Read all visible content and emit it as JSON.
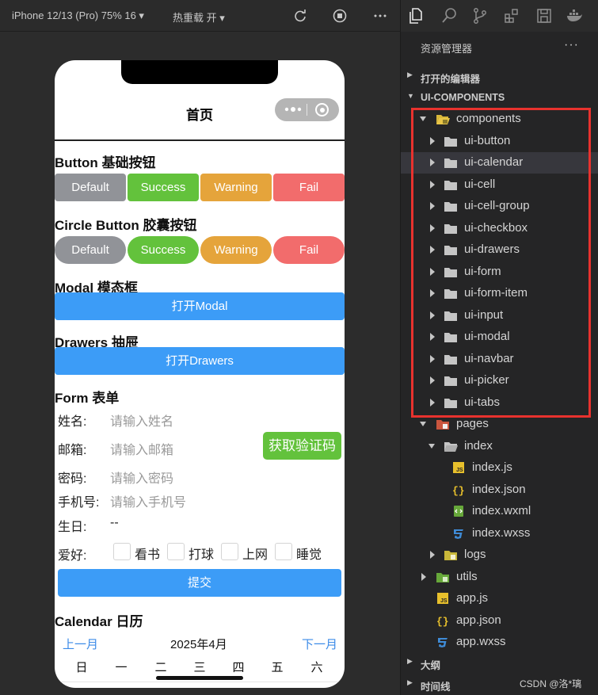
{
  "toolbar": {
    "device": "iPhone 12/13 (Pro) 75% 16 ▾",
    "hot_reload": "热重载 开 ▾"
  },
  "phone": {
    "title": "首页",
    "button_section": {
      "title": "Button 基础按钮",
      "buttons": [
        "Default",
        "Success",
        "Warning",
        "Fail"
      ]
    },
    "circle_section": {
      "title": "Circle Button 胶囊按钮",
      "buttons": [
        "Default",
        "Success",
        "Warning",
        "Fail"
      ]
    },
    "modal_section": {
      "title": "Modal 模态框",
      "button": "打开Modal"
    },
    "drawers_section": {
      "title": "Drawers 抽屉",
      "button": "打开Drawers"
    },
    "form": {
      "title": "Form 表单",
      "name_label": "姓名:",
      "name_placeholder": "请输入姓名",
      "email_label": "邮箱:",
      "email_placeholder": "请输入邮箱",
      "code_button": "获取验证码",
      "password_label": "密码:",
      "password_placeholder": "请输入密码",
      "phone_label": "手机号:",
      "phone_placeholder": "请输入手机号",
      "birthday_label": "生日:",
      "birthday_value": "--",
      "hobby_label": "爱好:",
      "hobbies": [
        "看书",
        "打球",
        "上网",
        "睡觉"
      ],
      "submit": "提交"
    },
    "calendar": {
      "title": "Calendar 日历",
      "prev": "上一月",
      "month": "2025年4月",
      "next": "下一月",
      "weekdays": [
        "日",
        "一",
        "二",
        "三",
        "四",
        "五",
        "六"
      ]
    }
  },
  "explorer": {
    "header": "资源管理器",
    "more": "···",
    "open_editors": "打开的编辑器",
    "project": "UI-COMPONENTS",
    "outline": "大纲",
    "timeline": "时间线",
    "tree": {
      "components": "components",
      "component_items": [
        "ui-button",
        "ui-calendar",
        "ui-cell",
        "ui-cell-group",
        "ui-checkbox",
        "ui-drawers",
        "ui-form",
        "ui-form-item",
        "ui-input",
        "ui-modal",
        "ui-navbar",
        "ui-picker",
        "ui-tabs"
      ],
      "pages": "pages",
      "index": "index",
      "index_files": [
        "index.js",
        "index.json",
        "index.wxml",
        "index.wxss"
      ],
      "logs": "logs",
      "utils": "utils",
      "root_files": [
        "app.js",
        "app.json",
        "app.wxss"
      ]
    }
  },
  "watermark": "CSDN @洛*璃",
  "colors": {
    "gray": "#919398",
    "success": "#63c23c",
    "warning": "#e5a43b",
    "fail": "#f26c6c",
    "primary": "#3c9cf7",
    "highlight_box": "#e8322e"
  }
}
